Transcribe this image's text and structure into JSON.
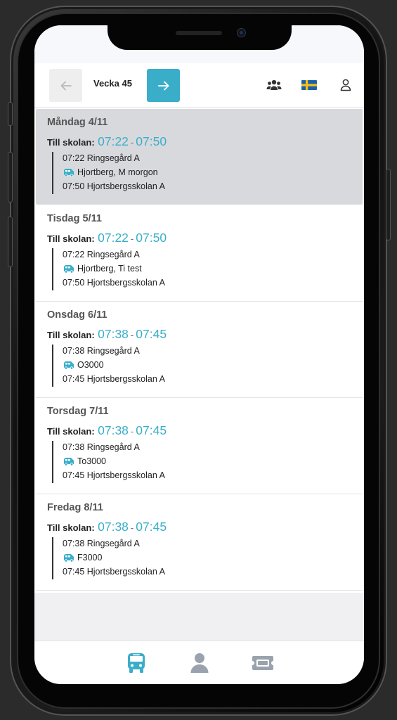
{
  "header": {
    "week_label": "Vecka 45",
    "prev_icon": "arrow-left-icon",
    "next_icon": "arrow-right-icon",
    "group_icon": "users-icon",
    "language_icon": "swedish-flag-icon",
    "profile_icon": "user-icon"
  },
  "colors": {
    "accent": "#3aaec9",
    "selected_bg": "#d8d9dd",
    "tab_inactive": "#9aa3ad"
  },
  "days": [
    {
      "title": "Måndag 4/11",
      "till_label": "Till skolan:",
      "start": "07:22",
      "end": "07:50",
      "stop_from": "07:22 Ringsegård A",
      "bus": "Hjortberg, M morgon",
      "stop_to": "07:50 Hjortsbergsskolan A",
      "selected": true
    },
    {
      "title": "Tisdag 5/11",
      "till_label": "Till skolan:",
      "start": "07:22",
      "end": "07:50",
      "stop_from": "07:22 Ringsegård A",
      "bus": "Hjortberg, Ti test",
      "stop_to": "07:50 Hjortsbergsskolan A",
      "selected": false
    },
    {
      "title": "Onsdag 6/11",
      "till_label": "Till skolan:",
      "start": "07:38",
      "end": "07:45",
      "stop_from": "07:38 Ringsegård A",
      "bus": "O3000",
      "stop_to": "07:45 Hjortsbergsskolan A",
      "selected": false
    },
    {
      "title": "Torsdag 7/11",
      "till_label": "Till skolan:",
      "start": "07:38",
      "end": "07:45",
      "stop_from": "07:38 Ringsegård A",
      "bus": "To3000",
      "stop_to": "07:45 Hjortsbergsskolan A",
      "selected": false
    },
    {
      "title": "Fredag 8/11",
      "till_label": "Till skolan:",
      "start": "07:38",
      "end": "07:45",
      "stop_from": "07:38 Ringsegård A",
      "bus": "F3000",
      "stop_to": "07:45 Hjortsbergsskolan A",
      "selected": false
    }
  ],
  "dash": "-",
  "tabs": [
    {
      "icon": "bus-icon",
      "active": true
    },
    {
      "icon": "person-icon",
      "active": false
    },
    {
      "icon": "ticket-icon",
      "active": false
    }
  ]
}
